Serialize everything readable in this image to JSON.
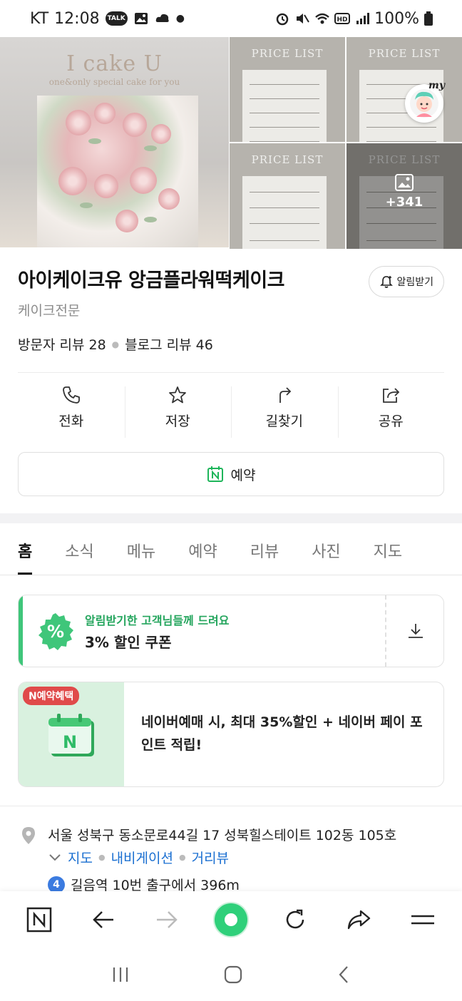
{
  "status_bar": {
    "carrier": "KT",
    "time": "12:08",
    "battery": "100%"
  },
  "photos": {
    "brand_title": "I cake U",
    "brand_subtitle": "one&only special cake for you",
    "price_list_label": "PRICE LIST",
    "more_count": "+341",
    "my_badge": "my"
  },
  "place": {
    "name": "아이케이크유 앙금플라워떡케이크",
    "category": "케이크전문",
    "notify_label": "알림받기",
    "visitor_reviews": "방문자 리뷰 28",
    "blog_reviews": "블로그 리뷰 46"
  },
  "actions": [
    {
      "label": "전화",
      "icon": "phone-icon"
    },
    {
      "label": "저장",
      "icon": "star-icon"
    },
    {
      "label": "길찾기",
      "icon": "directions-icon"
    },
    {
      "label": "공유",
      "icon": "share-icon"
    }
  ],
  "reserve_label": "예약",
  "tabs": [
    "홈",
    "소식",
    "메뉴",
    "예약",
    "리뷰",
    "사진",
    "지도"
  ],
  "coupon": {
    "subtitle": "알림받기한 고객님들께 드려요",
    "title": "3% 할인 쿠폰"
  },
  "promo": {
    "tag": "N예약혜택",
    "text": "네이버예매 시, 최대 35%할인 + 네이버 페이 포인트 적립!"
  },
  "address": {
    "line": "서울 성북구 동소문로44길 17 성북힐스테이트 102동 105호",
    "links": [
      "지도",
      "내비게이션",
      "거리뷰"
    ],
    "subway_line": "4",
    "subway_text": "길음역 10번 출구에서 396m"
  },
  "colors": {
    "naver_green": "#2fd07a",
    "coupon_green": "#24a55d",
    "link_blue": "#1a6fd1",
    "promo_red": "#e04a4a"
  }
}
